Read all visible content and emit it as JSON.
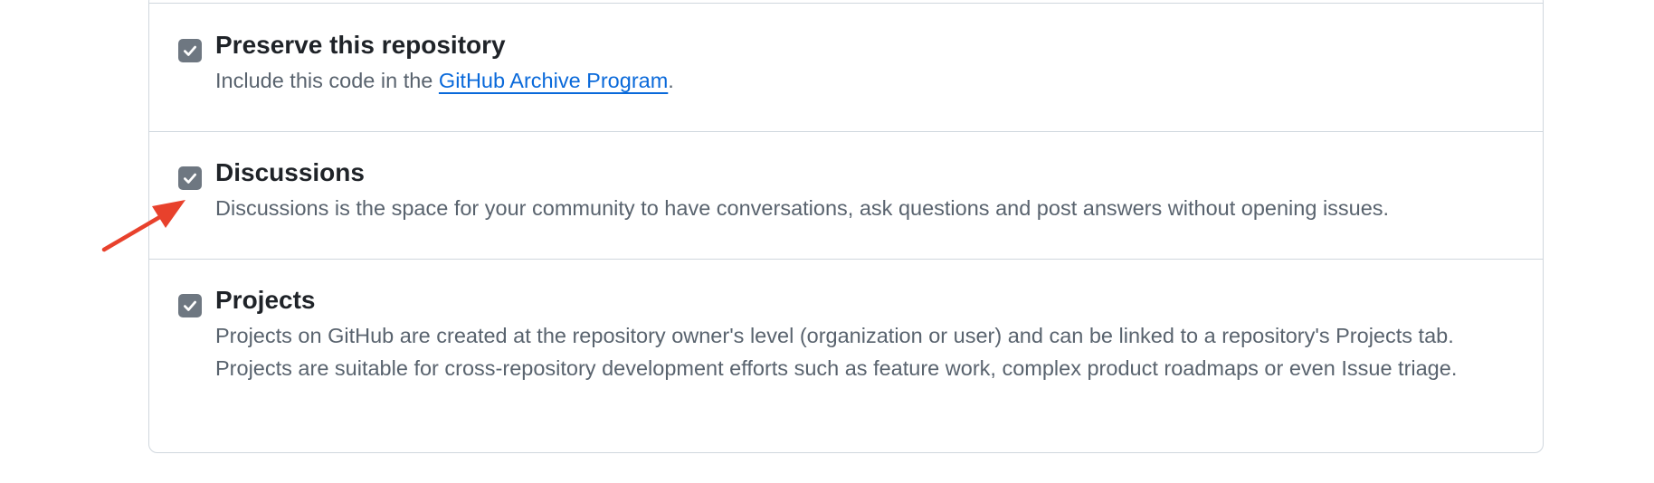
{
  "settings": {
    "items": [
      {
        "title": "Preserve this repository",
        "checked": true,
        "description_before": "Include this code in the ",
        "link_text": "GitHub Archive Program",
        "description_after": "."
      },
      {
        "title": "Discussions",
        "checked": true,
        "description": "Discussions is the space for your community to have conversations, ask questions and post answers without opening issues."
      },
      {
        "title": "Projects",
        "checked": true,
        "description": "Projects on GitHub are created at the repository owner's level (organization or user) and can be linked to a repository's Projects tab. Projects are suitable for cross-repository development efforts such as feature work, complex product roadmaps or even Issue triage."
      }
    ]
  },
  "annotation": {
    "arrow_icon": "red-arrow-icon",
    "arrow_color": "#e8412c",
    "points_to": "Discussions checkbox"
  },
  "colors": {
    "checkbox_fill": "#6e7781",
    "link": "#0969da",
    "border": "#d0d7de",
    "description_text": "#59636e"
  }
}
